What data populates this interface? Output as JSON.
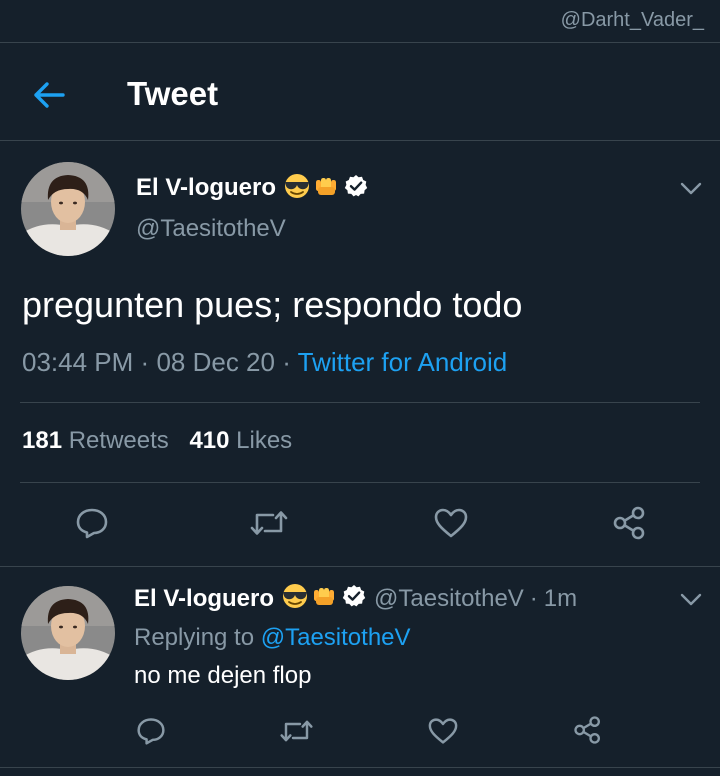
{
  "watermark": "@Darht_Vader_",
  "header": {
    "title": "Tweet"
  },
  "main_tweet": {
    "display_name": "El V-loguero",
    "handle": "@TaesitotheV",
    "text": "pregunten pues; respondo todo",
    "time": "03:44 PM",
    "separator": "·",
    "date": "08 Dec 20",
    "source": "Twitter for Android",
    "stats": {
      "retweets_count": "181",
      "retweets_label": "Retweets",
      "likes_count": "410",
      "likes_label": "Likes"
    }
  },
  "reply": {
    "display_name": "El V-loguero",
    "handle": "@TaesitotheV",
    "separator": "·",
    "age": "1m",
    "replying_label": "Replying to",
    "replying_to": "@TaesitotheV",
    "text": "no me dejen flop"
  },
  "icons": [
    "back-arrow-icon",
    "sunglasses-emoji-icon",
    "fist-emoji-icon",
    "verified-badge-icon",
    "chevron-down-icon",
    "reply-icon",
    "retweet-icon",
    "like-icon",
    "share-icon"
  ],
  "colors": {
    "background": "#15202b",
    "accent": "#1da1f2",
    "muted": "#8899a6",
    "divider": "#38444d"
  }
}
